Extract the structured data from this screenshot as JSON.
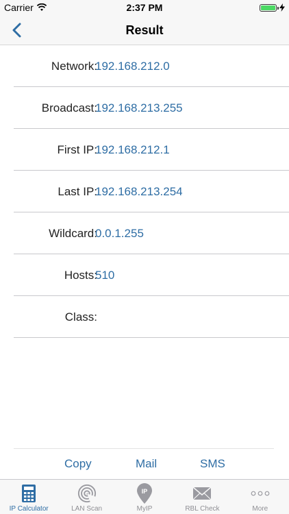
{
  "status_bar": {
    "carrier": "Carrier",
    "time": "2:37 PM"
  },
  "nav": {
    "title": "Result"
  },
  "results": [
    {
      "label": "Network:",
      "value": "192.168.212.0"
    },
    {
      "label": "Broadcast:",
      "value": "192.168.213.255"
    },
    {
      "label": "First IP:",
      "value": "192.168.212.1"
    },
    {
      "label": "Last IP:",
      "value": "192.168.213.254"
    },
    {
      "label": "Wildcard:",
      "value": "0.0.1.255"
    },
    {
      "label": "Hosts:",
      "value": "510"
    },
    {
      "label": "Class:",
      "value": ""
    }
  ],
  "actions": {
    "copy": "Copy",
    "mail": "Mail",
    "sms": "SMS"
  },
  "tabs": [
    {
      "label": "IP Calculator",
      "icon": "calculator-icon",
      "active": true
    },
    {
      "label": "LAN Scan",
      "icon": "radar-icon",
      "active": false
    },
    {
      "label": "MyIP",
      "icon": "map-pin-icon",
      "active": false,
      "badge": "IP"
    },
    {
      "label": "RBL Check",
      "icon": "envelope-icon",
      "active": false
    },
    {
      "label": "More",
      "icon": "more-icon",
      "active": false
    }
  ],
  "colors": {
    "accent": "#2e6da4",
    "inactive": "#8e8e93",
    "battery": "#4cd964"
  }
}
